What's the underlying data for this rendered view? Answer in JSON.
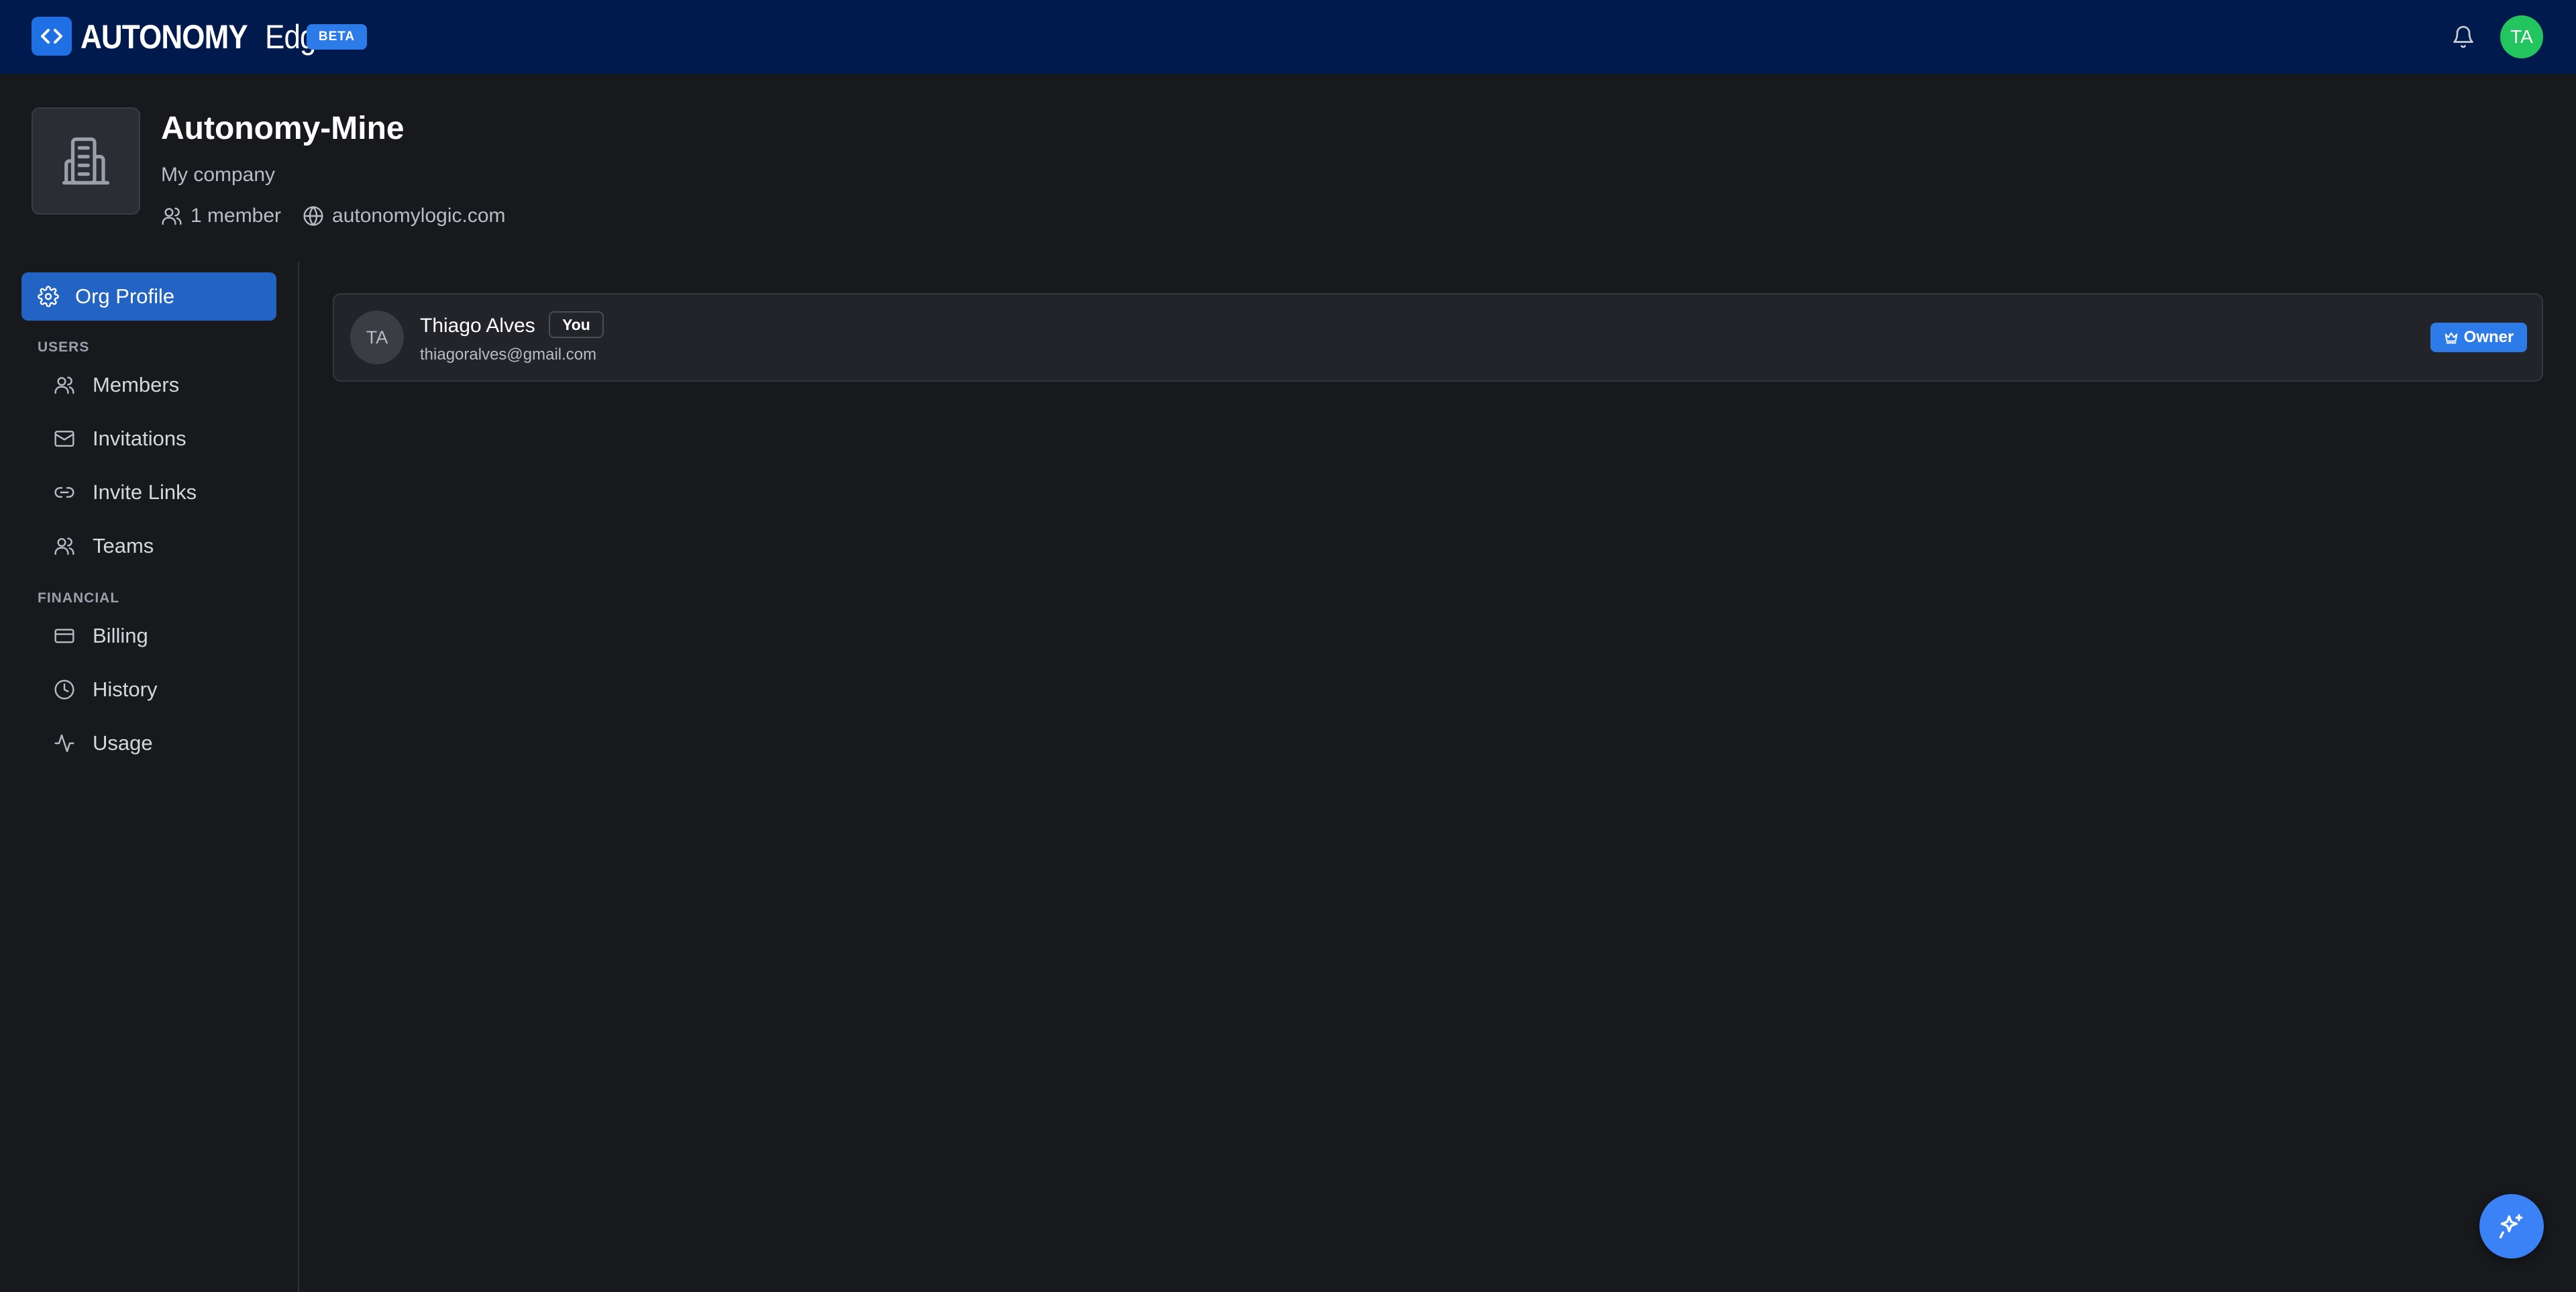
{
  "app": {
    "brand_strong": "AUTONOMY",
    "brand_light": "Edge",
    "beta_label": "BETA",
    "user_initials": "TA"
  },
  "org": {
    "name": "Autonomy-Mine",
    "description": "My company",
    "member_count": "1 member",
    "website": "autonomylogic.com"
  },
  "sidebar": {
    "active_item": {
      "label": "Org Profile",
      "icon": "gear-icon"
    },
    "sections": [
      {
        "label": "USERS",
        "items": [
          {
            "label": "Members",
            "icon": "users-icon"
          },
          {
            "label": "Invitations",
            "icon": "mail-icon"
          },
          {
            "label": "Invite Links",
            "icon": "link-icon"
          },
          {
            "label": "Teams",
            "icon": "users-icon"
          }
        ]
      },
      {
        "label": "FINANCIAL",
        "items": [
          {
            "label": "Billing",
            "icon": "credit-card-icon"
          },
          {
            "label": "History",
            "icon": "clock-icon"
          },
          {
            "label": "Usage",
            "icon": "activity-icon"
          }
        ]
      }
    ]
  },
  "members": [
    {
      "initials": "TA",
      "name": "Thiago Alves",
      "you_badge": "You",
      "email": "thiagoralves@gmail.com",
      "role": "Owner"
    }
  ],
  "colors": {
    "topbar": "#011a4d",
    "accent": "#2d7be8",
    "active_nav": "#2363c4",
    "avatar_green": "#22c55e"
  }
}
